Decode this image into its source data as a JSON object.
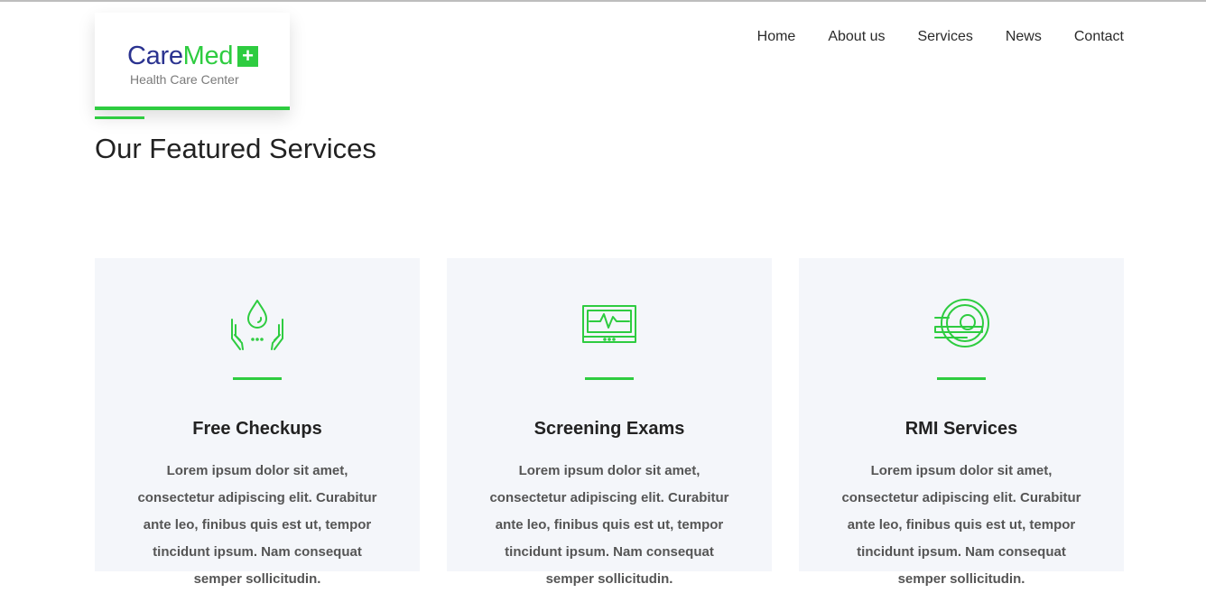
{
  "brand": {
    "name_part1": "Care",
    "name_part2": "Med",
    "plus": "+",
    "tagline": "Health Care Center",
    "primary_color": "#2b3390",
    "accent_color": "#2ecc40"
  },
  "nav": {
    "items": [
      {
        "label": "Home"
      },
      {
        "label": "About us"
      },
      {
        "label": "Services"
      },
      {
        "label": "News"
      },
      {
        "label": "Contact"
      }
    ]
  },
  "section": {
    "title": "Our Featured Services"
  },
  "services": [
    {
      "icon": "water-drop-hands-icon",
      "title": "Free Checkups",
      "text": "Lorem ipsum dolor sit amet, consectetur adipiscing elit. Curabitur ante leo, finibus quis est ut, tempor tincidunt ipsum. Nam consequat semper sollicitudin."
    },
    {
      "icon": "heart-monitor-icon",
      "title": "Screening Exams",
      "text": "Lorem ipsum dolor sit amet, consectetur adipiscing elit. Curabitur ante leo, finibus quis est ut, tempor tincidunt ipsum. Nam consequat semper sollicitudin."
    },
    {
      "icon": "mri-scanner-icon",
      "title": "RMI Services",
      "text": "Lorem ipsum dolor sit amet, consectetur adipiscing elit. Curabitur ante leo, finibus quis est ut, tempor tincidunt ipsum. Nam consequat semper sollicitudin."
    }
  ]
}
